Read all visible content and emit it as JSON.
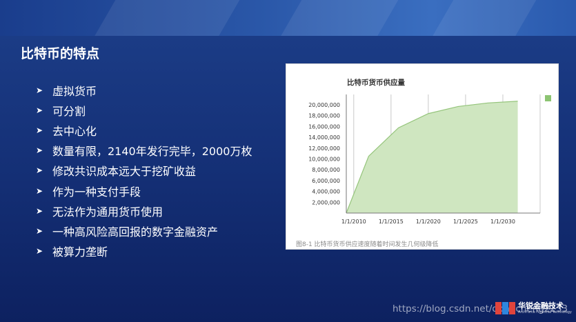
{
  "slide": {
    "title": "比特币的特点",
    "bullets": [
      "虚拟货币",
      "可分割",
      "去中心化",
      "数量有限，2140年发行完毕，2000万枚",
      "修改共识成本远大于挖矿收益",
      "作为一种支付手段",
      "无法作为通用货币使用",
      "一种高风险高回报的数字金融资产",
      "被算力垄断"
    ],
    "bullet_icon": "chevron-right-icon",
    "caption": "图8-1 比特币货币供应速度随着时间发生几何级降低",
    "watermark": "https://blog.csdn.net/dongcheng2233",
    "logo": {
      "cn": "华锐金融技术",
      "en": "ArchForce Financial Technology"
    }
  },
  "chart_data": {
    "type": "area",
    "title": "比特币货币供应量",
    "x": [
      2009,
      2012,
      2016,
      2020,
      2024,
      2028,
      2032
    ],
    "y": [
      0,
      10500000,
      15750000,
      18375000,
      19687500,
      20343750,
      20671875
    ],
    "x_ticks": [
      2010,
      2015,
      2020,
      2025,
      2030
    ],
    "x_tick_labels": [
      "1/1/2010",
      "1/1/2015",
      "1/1/2020",
      "1/1/2025",
      "1/1/2030"
    ],
    "y_ticks": [
      2000000,
      4000000,
      6000000,
      8000000,
      10000000,
      12000000,
      14000000,
      16000000,
      18000000,
      20000000
    ],
    "y_tick_labels": [
      "2,000,000",
      "4,000,000",
      "6,000,000",
      "8,000,000",
      "10,000,000",
      "12,000,000",
      "14,000,000",
      "16,000,000",
      "18,000,000",
      "20,000,000"
    ],
    "xlim": [
      2009,
      2035
    ],
    "ylim": [
      0,
      21400000
    ],
    "grid": "vertical",
    "legend": "top-right",
    "colors": {
      "fill": "#cfe6c0",
      "line": "#94c47a",
      "legend": "#8cc472",
      "grid": "#c8c8c8",
      "axis": "#777777"
    }
  }
}
